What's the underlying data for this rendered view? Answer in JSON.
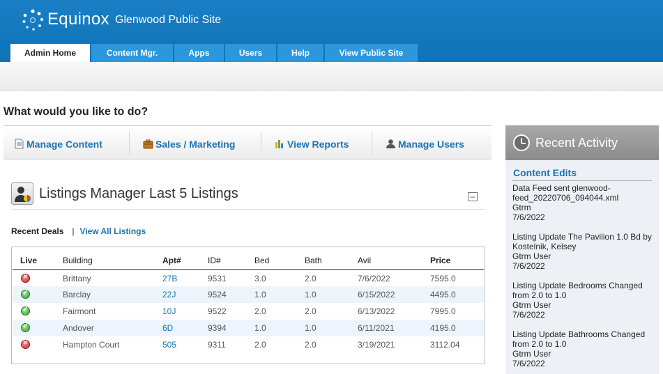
{
  "header": {
    "brand": "Equinox",
    "site_name": "Glenwood Public Site",
    "tabs": [
      "Admin Home",
      "Content Mgr.",
      "Apps",
      "Users",
      "Help",
      "View Public Site"
    ],
    "colors": {
      "header": "#1577bd",
      "tab": "#2d97dc",
      "link": "#1a74b5"
    }
  },
  "main": {
    "question": "What would you like to do?",
    "actions": [
      {
        "label": "Manage Content",
        "icon": "document-icon"
      },
      {
        "label": "Sales / Marketing",
        "icon": "briefcase-icon"
      },
      {
        "label": "View Reports",
        "icon": "bar-chart-icon"
      },
      {
        "label": "Manage Users",
        "icon": "user-icon"
      }
    ]
  },
  "listings": {
    "title": "Listings Manager Last 5 Listings",
    "collapse_symbol": "–",
    "recent_deals": "Recent Deals",
    "separator": "|",
    "view_all": "View All Listings",
    "columns": [
      "Live",
      "Building",
      "Apt#",
      "ID#",
      "Bed",
      "Bath",
      "Avil",
      "Price"
    ],
    "rows": [
      {
        "live": false,
        "building": "Brittany",
        "apt": "27B",
        "id": "9531",
        "bed": "3.0",
        "bath": "2.0",
        "avil": "7/6/2022",
        "price": "7595.0"
      },
      {
        "live": true,
        "building": "Barclay",
        "apt": "22J",
        "id": "9524",
        "bed": "1.0",
        "bath": "1.0",
        "avil": "6/15/2022",
        "price": "4495.0"
      },
      {
        "live": true,
        "building": "Fairmont",
        "apt": "10J",
        "id": "9522",
        "bed": "2.0",
        "bath": "2.0",
        "avil": "6/13/2022",
        "price": "7995.0"
      },
      {
        "live": true,
        "building": "Andover",
        "apt": "6D",
        "id": "9394",
        "bed": "1.0",
        "bath": "1.0",
        "avil": "6/11/2021",
        "price": "4195.0"
      },
      {
        "live": false,
        "building": "Hampton Court",
        "apt": "505",
        "id": "9311",
        "bed": "2.0",
        "bath": "2.0",
        "avil": "3/19/2021",
        "price": "3112.04"
      }
    ]
  },
  "sidebar": {
    "title": "Recent Activity",
    "section": "Content Edits",
    "entries": [
      {
        "text": "Data Feed sent glenwood-feed_20220706_094044.xml",
        "user": "Gtrm",
        "date": "7/6/2022"
      },
      {
        "text": "Listing Update The Pavilion 1.0 Bd by Kostelnik, Kelsey",
        "user": "Gtrm User",
        "date": "7/6/2022"
      },
      {
        "text": "Listing Update Bedrooms Changed from 2.0 to 1.0",
        "user": "Gtrm User",
        "date": "7/6/2022"
      },
      {
        "text": "Listing Update Bathrooms Changed from 2.0 to 1.0",
        "user": "Gtrm User",
        "date": "7/6/2022"
      }
    ]
  }
}
